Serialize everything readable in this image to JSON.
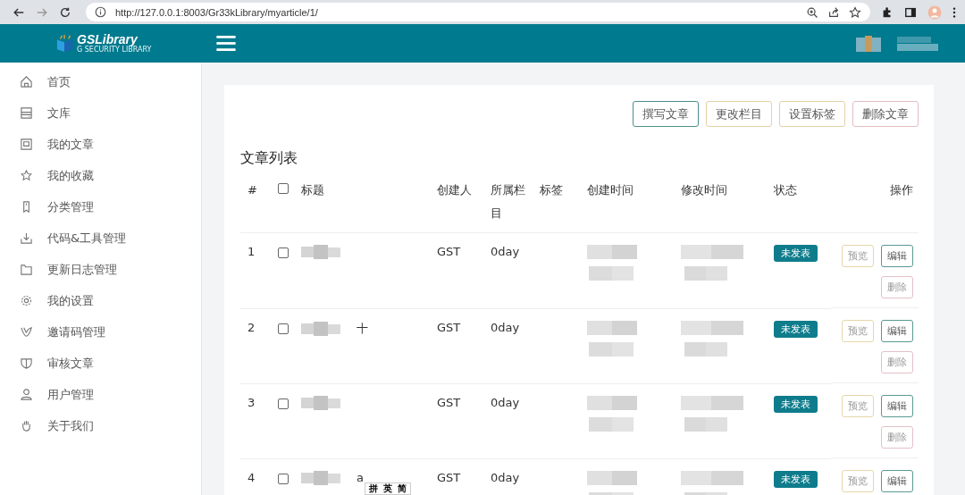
{
  "browser": {
    "url": "http://127.0.0.1:8003/Gr33kLibrary/myarticle/1/"
  },
  "header": {
    "logo": "GSLibrary",
    "tagline": "G SECURITY LIBRARY"
  },
  "sidebar": {
    "items": [
      {
        "label": "首页"
      },
      {
        "label": "文库"
      },
      {
        "label": "我的文章"
      },
      {
        "label": "我的收藏"
      },
      {
        "label": "分类管理"
      },
      {
        "label": "代码&工具管理"
      },
      {
        "label": "更新日志管理"
      },
      {
        "label": "我的设置"
      },
      {
        "label": "邀请码管理"
      },
      {
        "label": "审核文章"
      },
      {
        "label": "用户管理"
      },
      {
        "label": "关于我们"
      }
    ]
  },
  "toolbar": [
    {
      "label": "撰写文章",
      "color": "#4d8f8c"
    },
    {
      "label": "更改栏目",
      "color": "#e2d2a4"
    },
    {
      "label": "设置标签",
      "color": "#e2d2a4"
    },
    {
      "label": "删除文章",
      "color": "#e3bcc2"
    }
  ],
  "table": {
    "title": "文章列表",
    "select_all_checked": false,
    "columns": [
      "#",
      "标题",
      "创建人",
      "所属栏目",
      "标签",
      "创建时间",
      "修改时间",
      "状态",
      "操作"
    ],
    "rows": [
      {
        "num": "1",
        "checked": false,
        "title_tail": "",
        "author": "GST",
        "column": "0day",
        "status": "未发表",
        "actions": [
          {
            "label": "预览",
            "kind": "preview"
          },
          {
            "label": "编辑",
            "kind": "edit"
          },
          {
            "label": "删除",
            "kind": "delete"
          }
        ]
      },
      {
        "num": "2",
        "checked": false,
        "title_tail": "十",
        "author": "GST",
        "column": "0day",
        "status": "未发表",
        "actions": [
          {
            "label": "预览",
            "kind": "preview"
          },
          {
            "label": "编辑",
            "kind": "edit"
          },
          {
            "label": "删除",
            "kind": "delete"
          }
        ]
      },
      {
        "num": "3",
        "checked": false,
        "title_tail": "",
        "author": "GST",
        "column": "0day",
        "status": "未发表",
        "actions": [
          {
            "label": "预览",
            "kind": "preview"
          },
          {
            "label": "编辑",
            "kind": "edit"
          },
          {
            "label": "删除",
            "kind": "delete"
          }
        ]
      },
      {
        "num": "4",
        "checked": false,
        "title_tail": "a",
        "author": "GST",
        "column": "0day",
        "status": "未发表",
        "actions": [
          {
            "label": "预览",
            "kind": "preview"
          },
          {
            "label": "编辑",
            "kind": "edit"
          }
        ]
      }
    ]
  },
  "ime_bar": [
    "拼",
    "英",
    "简"
  ]
}
